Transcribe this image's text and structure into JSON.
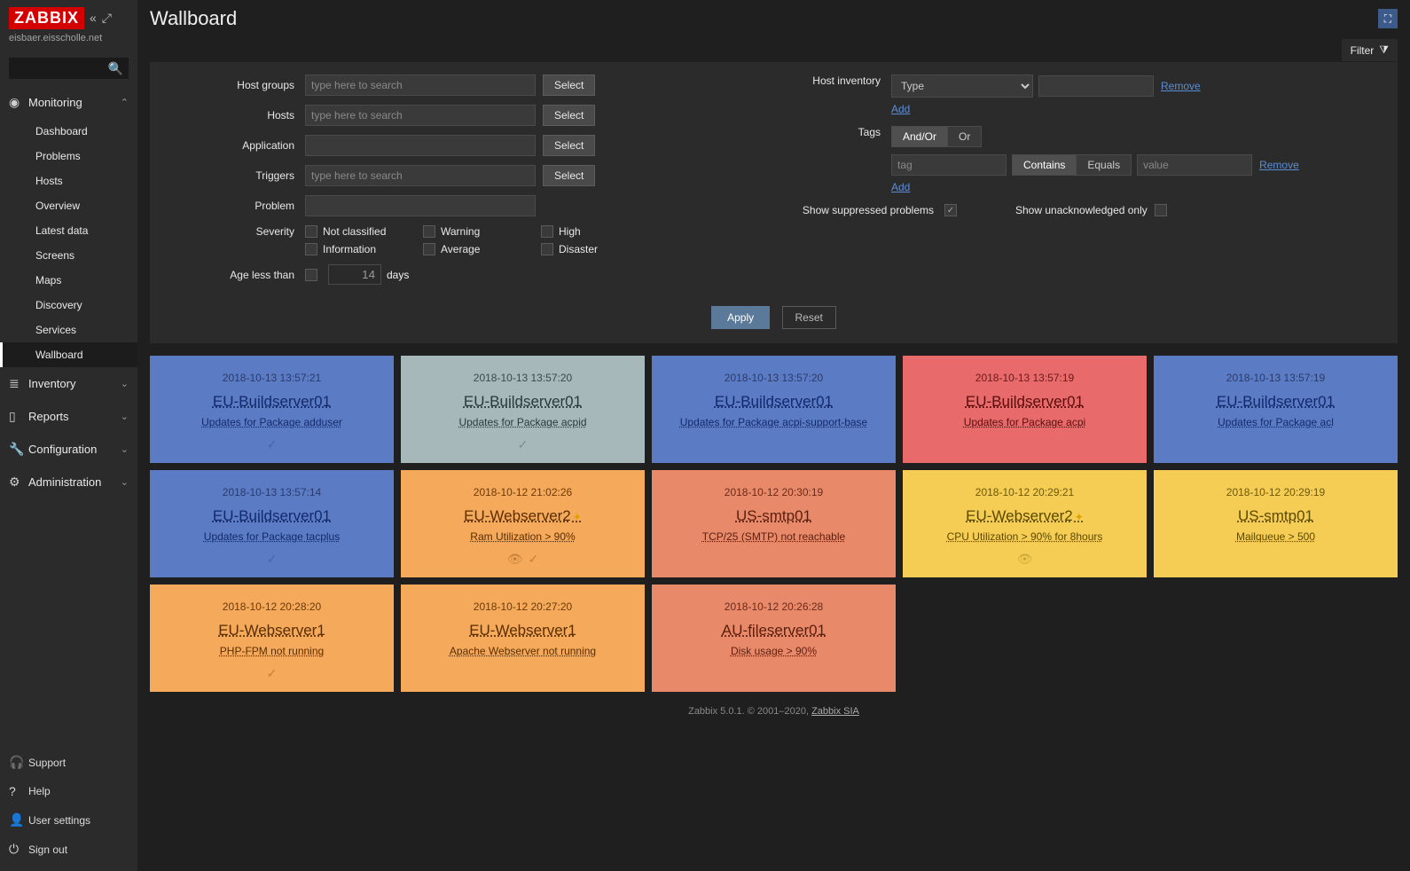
{
  "app": {
    "logo": "ZABBIX",
    "hostname": "eisbaer.eisscholle.net",
    "search_placeholder": ""
  },
  "nav": {
    "sections": [
      {
        "id": "monitoring",
        "label": "Monitoring",
        "icon": "◉",
        "expanded": true,
        "items": [
          {
            "label": "Dashboard",
            "active": false
          },
          {
            "label": "Problems",
            "active": false
          },
          {
            "label": "Hosts",
            "active": false
          },
          {
            "label": "Overview",
            "active": false
          },
          {
            "label": "Latest data",
            "active": false
          },
          {
            "label": "Screens",
            "active": false
          },
          {
            "label": "Maps",
            "active": false
          },
          {
            "label": "Discovery",
            "active": false
          },
          {
            "label": "Services",
            "active": false
          },
          {
            "label": "Wallboard",
            "active": true
          }
        ]
      },
      {
        "id": "inventory",
        "label": "Inventory",
        "icon": "≣",
        "expanded": false
      },
      {
        "id": "reports",
        "label": "Reports",
        "icon": "▯",
        "expanded": false
      },
      {
        "id": "configuration",
        "label": "Configuration",
        "icon": "🔧",
        "expanded": false
      },
      {
        "id": "administration",
        "label": "Administration",
        "icon": "⚙",
        "expanded": false
      }
    ],
    "footer": [
      {
        "label": "Support",
        "icon": "🎧"
      },
      {
        "label": "Help",
        "icon": "?"
      },
      {
        "label": "User settings",
        "icon": "👤"
      },
      {
        "label": "Sign out",
        "icon": "⏻"
      }
    ]
  },
  "page": {
    "title": "Wallboard",
    "filter_label": "Filter"
  },
  "filter": {
    "labels": {
      "host_groups": "Host groups",
      "hosts": "Hosts",
      "application": "Application",
      "triggers": "Triggers",
      "problem": "Problem",
      "severity": "Severity",
      "age": "Age less than",
      "host_inventory": "Host inventory",
      "tags": "Tags",
      "suppressed": "Show suppressed problems",
      "unack": "Show unacknowledged only"
    },
    "placeholder_search": "type here to search",
    "placeholder_tag": "tag",
    "placeholder_value": "value",
    "select_btn": "Select",
    "inventory_type": "Type",
    "add": "Add",
    "remove": "Remove",
    "tags_mode": {
      "andor": "And/Or",
      "or": "Or"
    },
    "tags_op": {
      "contains": "Contains",
      "equals": "Equals"
    },
    "severity_options": [
      "Not classified",
      "Warning",
      "High",
      "Information",
      "Average",
      "Disaster"
    ],
    "age_value": "14",
    "age_unit": "days",
    "apply": "Apply",
    "reset": "Reset"
  },
  "tiles": [
    {
      "time": "2018-10-13 13:57:21",
      "host": "EU-Buildserver01",
      "problem": "Updates for Package adduser",
      "sev": "blue",
      "ack": true
    },
    {
      "time": "2018-10-13 13:57:20",
      "host": "EU-Buildserver01",
      "problem": "Updates for Package acpid",
      "sev": "gray",
      "ack": true
    },
    {
      "time": "2018-10-13 13:57:20",
      "host": "EU-Buildserver01",
      "problem": "Updates for Package acpi-support-base",
      "sev": "blue"
    },
    {
      "time": "2018-10-13 13:57:19",
      "host": "EU-Buildserver01",
      "problem": "Updates for Package acpi",
      "sev": "red"
    },
    {
      "time": "2018-10-13 13:57:19",
      "host": "EU-Buildserver01",
      "problem": "Updates for Package acl",
      "sev": "blue"
    },
    {
      "time": "2018-10-13 13:57:14",
      "host": "EU-Buildserver01",
      "problem": "Updates for Package tacplus",
      "sev": "blue",
      "ack": true
    },
    {
      "time": "2018-10-12 21:02:26",
      "host": "EU-Webserver2",
      "problem": "Ram Utilization > 90%",
      "sev": "orange",
      "maint": true,
      "suppressed": true,
      "ack": true
    },
    {
      "time": "2018-10-12 20:30:19",
      "host": "US-smtp01",
      "problem": "TCP/25 (SMTP) not reachable",
      "sev": "salmon"
    },
    {
      "time": "2018-10-12 20:29:21",
      "host": "EU-Webserver2",
      "problem": "CPU Utilization > 90% for 8hours",
      "sev": "yellow",
      "maint": true,
      "suppressed": true
    },
    {
      "time": "2018-10-12 20:29:19",
      "host": "US-smtp01",
      "problem": "Mailqueue > 500",
      "sev": "yellow"
    },
    {
      "time": "2018-10-12 20:28:20",
      "host": "EU-Webserver1",
      "problem": "PHP-FPM not running",
      "sev": "orange",
      "ack": true
    },
    {
      "time": "2018-10-12 20:27:20",
      "host": "EU-Webserver1",
      "problem": "Apache Webserver not running",
      "sev": "orange"
    },
    {
      "time": "2018-10-12 20:26:28",
      "host": "AU-fileserver01",
      "problem": "Disk usage > 90%",
      "sev": "salmon"
    }
  ],
  "footer_text": {
    "pre": "Zabbix 5.0.1. © 2001–2020, ",
    "link": "Zabbix SIA"
  }
}
